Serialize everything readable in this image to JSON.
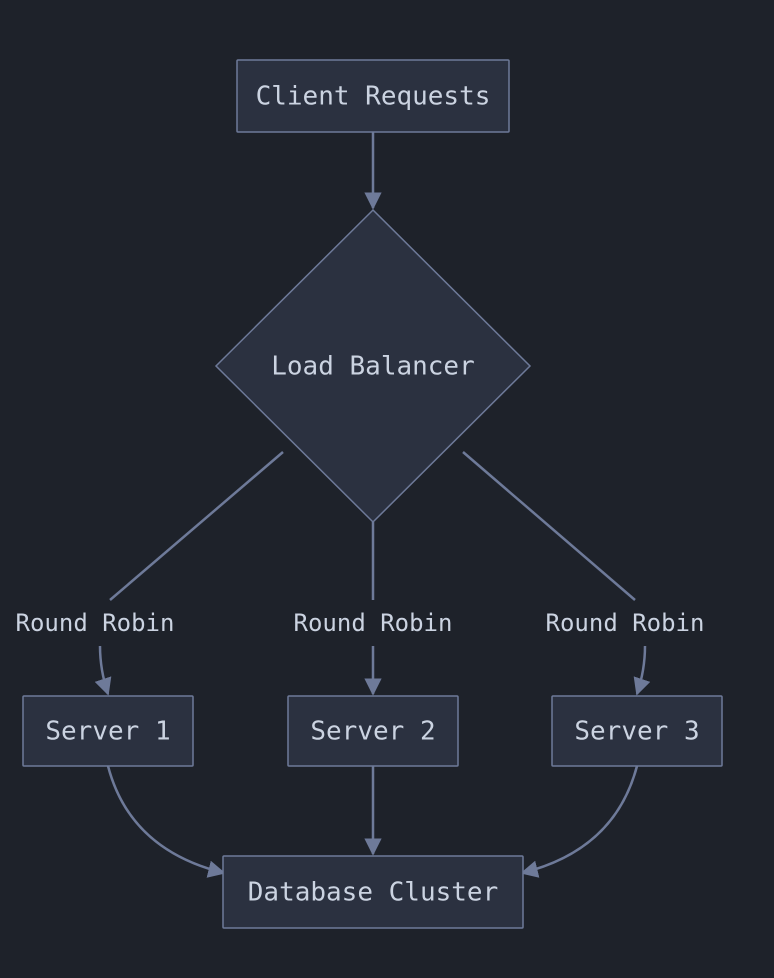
{
  "nodes": {
    "client": {
      "label": "Client Requests"
    },
    "lb": {
      "label": "Load Balancer"
    },
    "s1": {
      "label": "Server 1"
    },
    "s2": {
      "label": "Server 2"
    },
    "s3": {
      "label": "Server 3"
    },
    "db": {
      "label": "Database Cluster"
    }
  },
  "edges": {
    "lb_s1": {
      "label": "Round Robin"
    },
    "lb_s2": {
      "label": "Round Robin"
    },
    "lb_s3": {
      "label": "Round Robin"
    }
  }
}
